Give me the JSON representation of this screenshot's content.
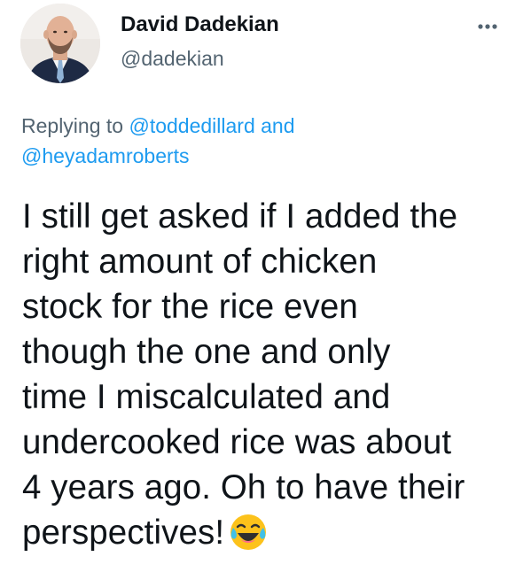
{
  "tweet": {
    "author": {
      "display_name": "David Dadekian",
      "handle": "@dadekian",
      "avatar_icon": "profile-photo"
    },
    "more_icon": "ellipsis-icon",
    "reply_context": {
      "prefix": "Replying to ",
      "mention_1": "@toddedillard",
      "joiner": " and",
      "mention_2": "@heyadamroberts"
    },
    "text_lines": [
      "I still get asked if I added the",
      "right amount of chicken",
      "stock for the rice even",
      "though the one and only",
      "time I miscalculated and",
      "undercooked rice was about",
      "4 years ago. Oh to have their",
      "perspectives!"
    ],
    "emoji": "face-with-tears-of-joy",
    "colors": {
      "text": "#0f1419",
      "secondary": "#536471",
      "link": "#1d9bf0"
    }
  }
}
